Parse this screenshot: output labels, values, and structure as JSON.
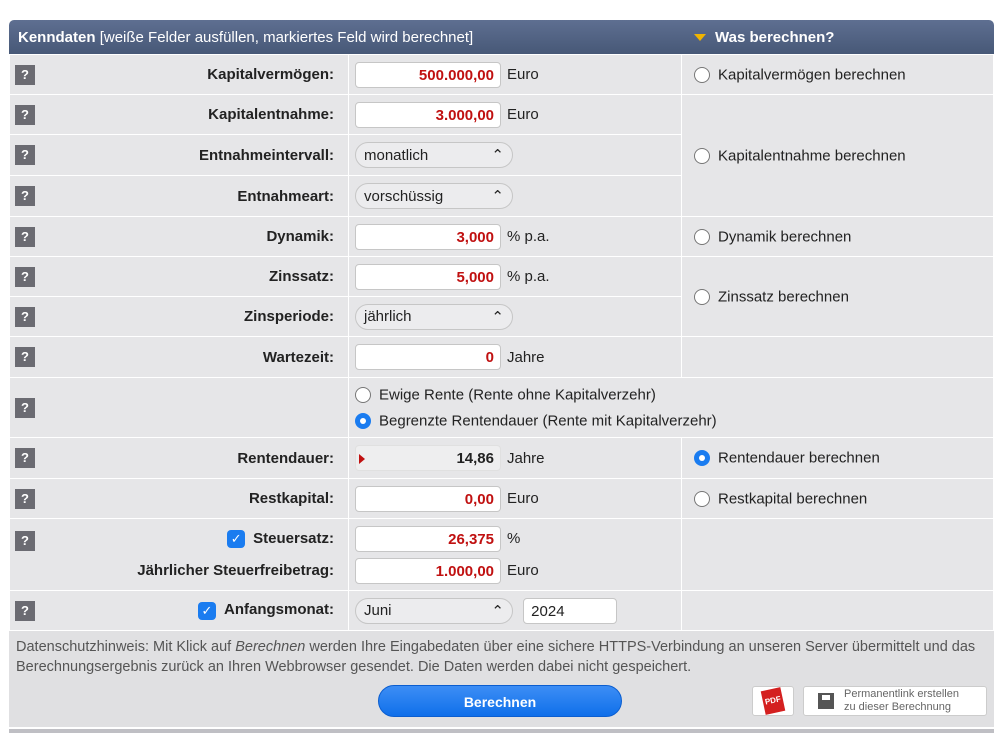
{
  "header": {
    "title": "Kenndaten",
    "subtitle": "[weiße Felder ausfüllen, markiertes Feld wird berechnet]",
    "right_title": "Was berechnen?"
  },
  "help_label": "?",
  "rows": {
    "kapitalvermoegen": {
      "label": "Kapitalvermögen:",
      "value": "500.000,00",
      "unit": "Euro",
      "option": "Kapitalvermögen berechnen"
    },
    "kapitalentnahme": {
      "label": "Kapitalentnahme:",
      "value": "3.000,00",
      "unit": "Euro",
      "option": "Kapitalentnahme berechnen"
    },
    "entnahmeintervall": {
      "label": "Entnahmeintervall:",
      "value": "monatlich"
    },
    "entnahmeart": {
      "label": "Entnahmeart:",
      "value": "vorschüssig"
    },
    "dynamik": {
      "label": "Dynamik:",
      "value": "3,000",
      "unit": "% p.a.",
      "option": "Dynamik berechnen"
    },
    "zinssatz": {
      "label": "Zinssatz:",
      "value": "5,000",
      "unit": "% p.a.",
      "option": "Zinssatz berechnen"
    },
    "zinsperiode": {
      "label": "Zinsperiode:",
      "value": "jährlich"
    },
    "wartezeit": {
      "label": "Wartezeit:",
      "value": "0",
      "unit": "Jahre"
    },
    "rentenart": {
      "option1": "Ewige Rente (Rente ohne Kapitalverzehr)",
      "option2": "Begrenzte Rentendauer (Rente mit Kapitalverzehr)"
    },
    "rentendauer": {
      "label": "Rentendauer:",
      "value": "14,86",
      "unit": "Jahre",
      "option": "Rentendauer berechnen"
    },
    "restkapital": {
      "label": "Restkapital:",
      "value": "0,00",
      "unit": "Euro",
      "option": "Restkapital berechnen"
    },
    "steuersatz": {
      "label": "Steuersatz:",
      "value": "26,375",
      "unit": "%",
      "checked": true
    },
    "freibetrag": {
      "label": "Jährlicher Steuerfreibetrag:",
      "value": "1.000,00",
      "unit": "Euro"
    },
    "anfangsmonat": {
      "label": "Anfangsmonat:",
      "month": "Juni",
      "year": "2024",
      "checked": true
    }
  },
  "footer": {
    "privacy_1": "Datenschutzhinweis: Mit Klick auf ",
    "privacy_em": "Berechnen",
    "privacy_2": " werden Ihre Eingabedaten über eine sichere HTTPS-Verbindung an unseren Server übermittelt und das Berechnungsergebnis zurück an Ihren Webbrowser gesendet. Die Daten werden dabei nicht gespeichert.",
    "button": "Berechnen",
    "pdf": "PDF",
    "permalink_1": "Permanentlink erstellen",
    "permalink_2": "zu dieser Berechnung"
  },
  "selected_calc": "rentendauer",
  "accent_color": "#1a7cf0",
  "value_color": "#c01010"
}
